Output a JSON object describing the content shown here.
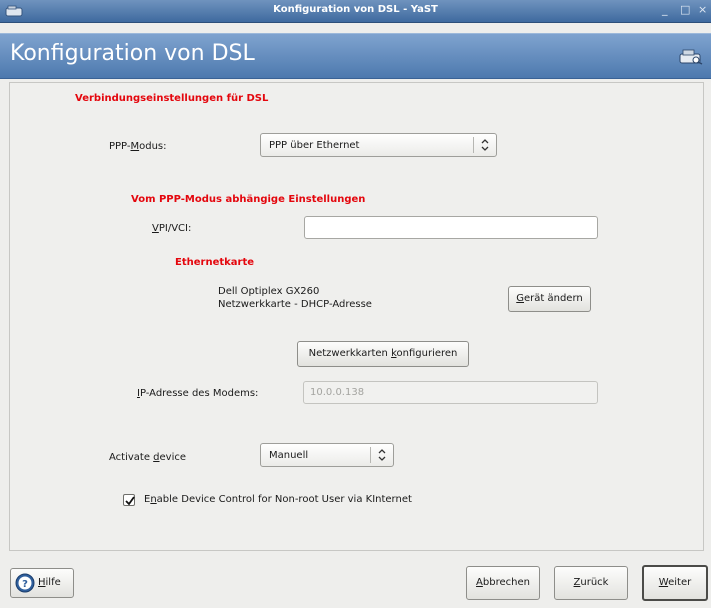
{
  "window": {
    "title": "Konfiguration von DSL - YaST",
    "controls": {
      "minimize": "_",
      "maximize": "□",
      "close": "×"
    }
  },
  "header": {
    "title": "Konfiguration von DSL",
    "icon": "network-modem-icon"
  },
  "main": {
    "section_connection": "Verbindungseinstellungen für DSL",
    "ppp_mode": {
      "label_pre": "PPP-",
      "label_accel": "M",
      "label_post": "odus:",
      "value": "PPP über Ethernet"
    },
    "section_mode_dependent": "Vom PPP-Modus abhängige Einstellungen",
    "vpi_vci": {
      "label_accel": "V",
      "label_post": "PI/VCI:",
      "value": ""
    },
    "section_ethernet": "Ethernetkarte",
    "ethernet": {
      "card_name": "Dell Optiplex GX260",
      "card_detail": "Netzwerkkarte - DHCP-Adresse",
      "change_pre": "",
      "change_accel": "G",
      "change_post": "erät ändern"
    },
    "configure_cards": {
      "pre": "Netzwerkkarten ",
      "accel": "k",
      "post": "onfigurieren"
    },
    "modem_ip": {
      "label_accel": "I",
      "label_post": "P-Adresse des Modems:",
      "value": "10.0.0.138"
    },
    "activate": {
      "label_pre": "Activate ",
      "label_accel": "d",
      "label_post": "evice",
      "value": "Manuell"
    },
    "nonroot": {
      "pre": "E",
      "accel": "n",
      "post": "able Device Control for Non-root User via KInternet",
      "checked": true
    }
  },
  "footer": {
    "help": {
      "accel": "H",
      "post": "ilfe"
    },
    "cancel": {
      "accel": "A",
      "post": "bbrechen"
    },
    "back": {
      "accel": "Z",
      "post": "urück"
    },
    "next": {
      "accel": "W",
      "post": "eiter"
    }
  },
  "colors": {
    "accent_red": "#e4060d",
    "header_blue": "#5f87b8"
  }
}
